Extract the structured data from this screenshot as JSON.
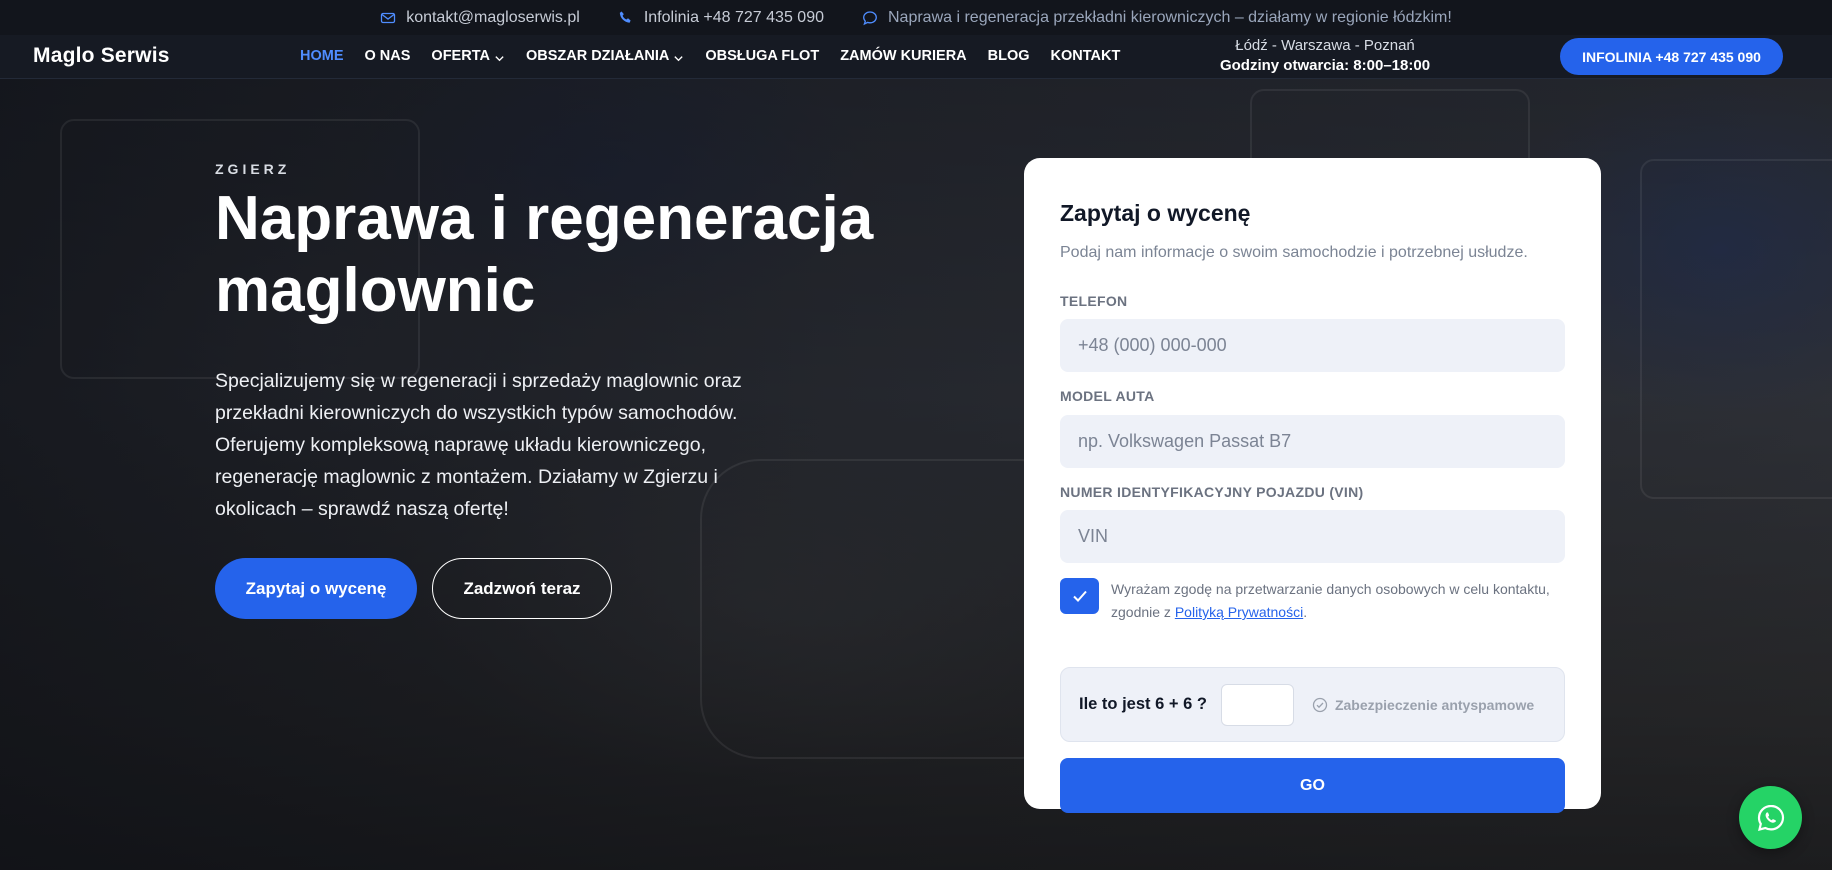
{
  "topbar": {
    "email": "kontakt@magloserwis.pl",
    "phone": "Infolinia +48 727 435 090",
    "notice": "Naprawa i regeneracja przekładni kierowniczych – działamy w regionie łódzkim!"
  },
  "nav": {
    "logo": "Maglo Serwis",
    "items": [
      {
        "label": "HOME",
        "active": true
      },
      {
        "label": "O NAS"
      },
      {
        "label": "OFERTA",
        "dropdown": true
      },
      {
        "label": "OBSZAR DZIAŁANIA",
        "dropdown": true
      },
      {
        "label": "OBSŁUGA FLOT"
      },
      {
        "label": "ZAMÓW KURIERA"
      },
      {
        "label": "BLOG"
      },
      {
        "label": "KONTAKT"
      }
    ],
    "locations": "Łódź - Warszawa - Poznań",
    "hours": "Godziny otwarcia: 8:00–18:00",
    "cta": "INFOLINIA +48 727 435 090"
  },
  "hero": {
    "eyebrow": "ZGIERZ",
    "title": "Naprawa i regeneracja maglownic",
    "description": "Specjalizujemy się w regeneracji i sprzedaży maglownic oraz przekładni kierowniczych do wszystkich typów samochodów. Oferujemy kompleksową naprawę układu kierowniczego, regenerację maglownic z montażem. Działamy w Zgierzu i okolicach – sprawdź naszą ofertę!",
    "primary_btn": "Zapytaj o wycenę",
    "secondary_btn": "Zadzwoń teraz"
  },
  "form": {
    "title": "Zapytaj o wycenę",
    "subtitle": "Podaj nam informacje o swoim samochodzie i potrzebnej usłudze.",
    "phone_label": "TELEFON",
    "phone_placeholder": "+48 (000) 000-000",
    "model_label": "MODEL AUTA",
    "model_placeholder": "np. Volkswagen Passat B7",
    "vin_label": "NUMER IDENTYFIKACYJNY POJAZDU (VIN)",
    "vin_placeholder": "VIN",
    "consent_text": "Wyrażam zgodę na przetwarzanie danych osobowych w celu kontaktu, zgodnie z",
    "consent_link": "Polityką Prywatności",
    "consent_end": ".",
    "consent_checked": true,
    "antispam_question": "Ile to jest 6 + 6 ?",
    "antispam_note": "Zabezpieczenie antyspamowe",
    "submit": "GO"
  },
  "colors": {
    "accent": "#2563eb",
    "whatsapp": "#25d366",
    "nav_active": "#4f8dff"
  },
  "icons": {
    "email": "mail-icon",
    "phone": "phone-icon",
    "notice": "chat-bubble-icon",
    "whatsapp": "whatsapp-icon"
  }
}
